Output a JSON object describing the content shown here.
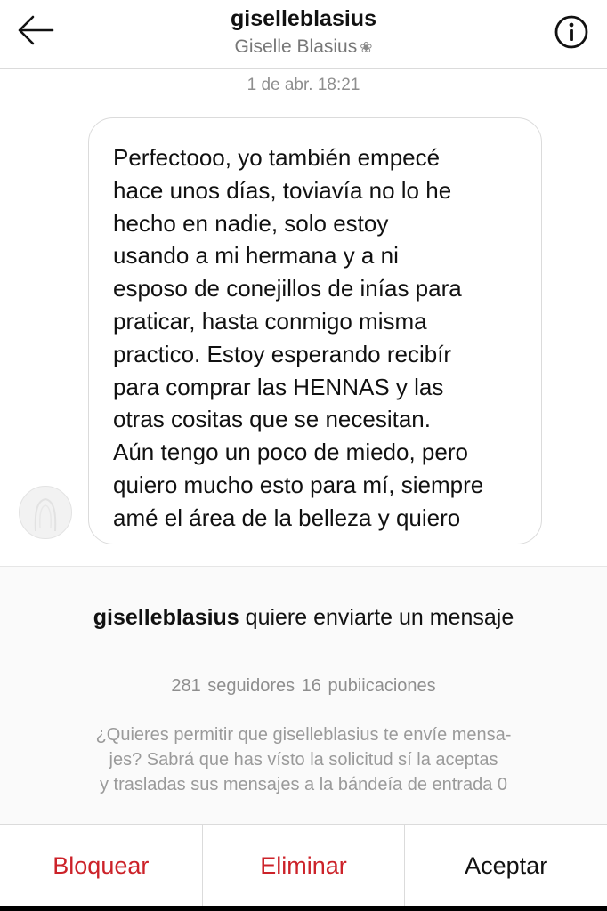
{
  "header": {
    "username": "giselleblasius",
    "display_name": "Giselle Blasius",
    "flower_glyph": "❀"
  },
  "icons": {
    "back": "arrow-left-icon",
    "info": "info-icon",
    "avatar": "avatar-placeholder"
  },
  "conversation": {
    "timestamp": "1 de abr. 18:21",
    "message": "Perfectooo, yo también empecé\nhace unos días, toviavía no lo he\nhecho en nadie, solo estoy\nusando a mi hermana y a ni\nesposo de conejillos de inías para\npraticar, hasta conmigo misma\npractico. Estoy esperando recibír\npara comprar las HENNAS y las\notras cositas que se necesitan.\nAún tengo un poco de miedo, pero\nquiero mucho esto para mí, siempre\namé el área de la belleza y quiero"
  },
  "request": {
    "username": "giselleblasius",
    "title_rest": " quiere enviarte un mensaje",
    "stats": "281 seguidores  16 pubiicaciones",
    "description": "¿Quieres permitir que giselleblasius te envíe mensa-\njes? Sabrá que has vísto la solicitud sí la aceptas\ny trasladas sus mensajes a la bándeía de entrada 0"
  },
  "actions": {
    "block": "Bloquear",
    "delete": "Eliminar",
    "accept": "Aceptar"
  },
  "colors": {
    "destructive": "#cc2229",
    "muted_text": "#8e8e8e",
    "border": "#dbdbdb",
    "panel_bg": "#fafafa"
  }
}
